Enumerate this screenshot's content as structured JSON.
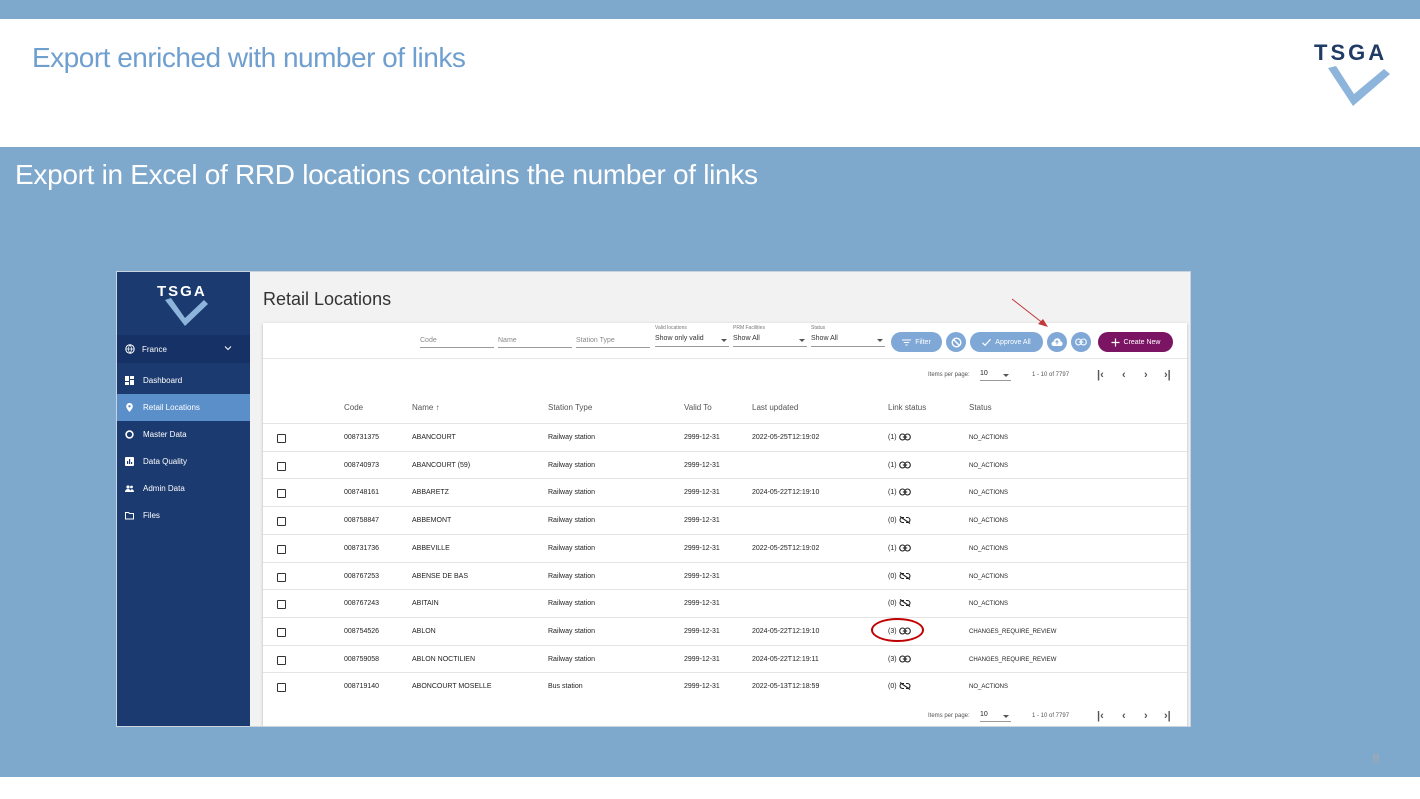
{
  "slide": {
    "title": "Export enriched with number of links",
    "subtitle": "Export in Excel of RRD locations contains the number of links",
    "page_number": "8",
    "logo_text": "TSGA"
  },
  "sidebar": {
    "country": "France",
    "items": [
      {
        "label": "Dashboard",
        "icon": "dashboard-icon"
      },
      {
        "label": "Retail Locations",
        "icon": "location-pin-icon",
        "active": true
      },
      {
        "label": "Master Data",
        "icon": "circle-icon"
      },
      {
        "label": "Data Quality",
        "icon": "chart-icon"
      },
      {
        "label": "Admin Data",
        "icon": "people-icon"
      },
      {
        "label": "Files",
        "icon": "folder-icon"
      }
    ]
  },
  "main": {
    "page_title": "Retail Locations",
    "filters": {
      "code_placeholder": "Code",
      "name_placeholder": "Name",
      "station_type_placeholder": "Station Type",
      "valid_locations_label": "Valid locations",
      "valid_locations_value": "Show only valid",
      "prm_label": "PRM Facilities",
      "prm_value": "Show All",
      "status_label": "Status",
      "status_value": "Show All"
    },
    "buttons": {
      "filter": "Filter",
      "approve_all": "Approve All",
      "create_new": "Create New"
    },
    "pager": {
      "items_per_page_label": "Items per page:",
      "items_per_page": "10",
      "range": "1 - 10 of 7797"
    },
    "columns": {
      "code": "Code",
      "name": "Name ↑",
      "station_type": "Station Type",
      "valid_to": "Valid To",
      "last_updated": "Last updated",
      "link_status": "Link status",
      "status": "Status"
    },
    "rows": [
      {
        "code": "008731375",
        "name": "ABANCOURT",
        "type": "Railway station",
        "valid_to": "2999-12-31",
        "updated": "2022-05-25T12:19:02",
        "links": "(1)",
        "linked": true,
        "status": "NO_ACTIONS"
      },
      {
        "code": "008740973",
        "name": "ABANCOURT (59)",
        "type": "Railway station",
        "valid_to": "2999-12-31",
        "updated": "",
        "links": "(1)",
        "linked": true,
        "status": "NO_ACTIONS"
      },
      {
        "code": "008748161",
        "name": "ABBARETZ",
        "type": "Railway station",
        "valid_to": "2999-12-31",
        "updated": "2024-05-22T12:19:10",
        "links": "(1)",
        "linked": true,
        "status": "NO_ACTIONS"
      },
      {
        "code": "008758847",
        "name": "ABBEMONT",
        "type": "Railway station",
        "valid_to": "2999-12-31",
        "updated": "",
        "links": "(0)",
        "linked": false,
        "status": "NO_ACTIONS"
      },
      {
        "code": "008731736",
        "name": "ABBEVILLE",
        "type": "Railway station",
        "valid_to": "2999-12-31",
        "updated": "2022-05-25T12:19:02",
        "links": "(1)",
        "linked": true,
        "status": "NO_ACTIONS"
      },
      {
        "code": "008767253",
        "name": "ABENSE DE BAS",
        "type": "Railway station",
        "valid_to": "2999-12-31",
        "updated": "",
        "links": "(0)",
        "linked": false,
        "status": "NO_ACTIONS"
      },
      {
        "code": "008767243",
        "name": "ABITAIN",
        "type": "Railway station",
        "valid_to": "2999-12-31",
        "updated": "",
        "links": "(0)",
        "linked": false,
        "status": "NO_ACTIONS"
      },
      {
        "code": "008754526",
        "name": "ABLON",
        "type": "Railway station",
        "valid_to": "2999-12-31",
        "updated": "2024-05-22T12:19:10",
        "links": "(3)",
        "linked": true,
        "status": "CHANGES_REQUIRE_REVIEW"
      },
      {
        "code": "008759058",
        "name": "ABLON NOCTILIEN",
        "type": "Railway station",
        "valid_to": "2999-12-31",
        "updated": "2024-05-22T12:19:11",
        "links": "(3)",
        "linked": true,
        "status": "CHANGES_REQUIRE_REVIEW"
      },
      {
        "code": "008719140",
        "name": "ABONCOURT MOSELLE",
        "type": "Bus station",
        "valid_to": "2999-12-31",
        "updated": "2022-05-13T12:18:59",
        "links": "(0)",
        "linked": false,
        "status": "NO_ACTIONS"
      }
    ]
  },
  "colors": {
    "band": "#7fa8cd",
    "title": "#6f9fcf",
    "sidebar": "#1b3a70",
    "sidebar_active": "#5b8fc9",
    "button_light": "#7fa8d6",
    "button_purple": "#7b1463",
    "highlight": "#c00000"
  }
}
